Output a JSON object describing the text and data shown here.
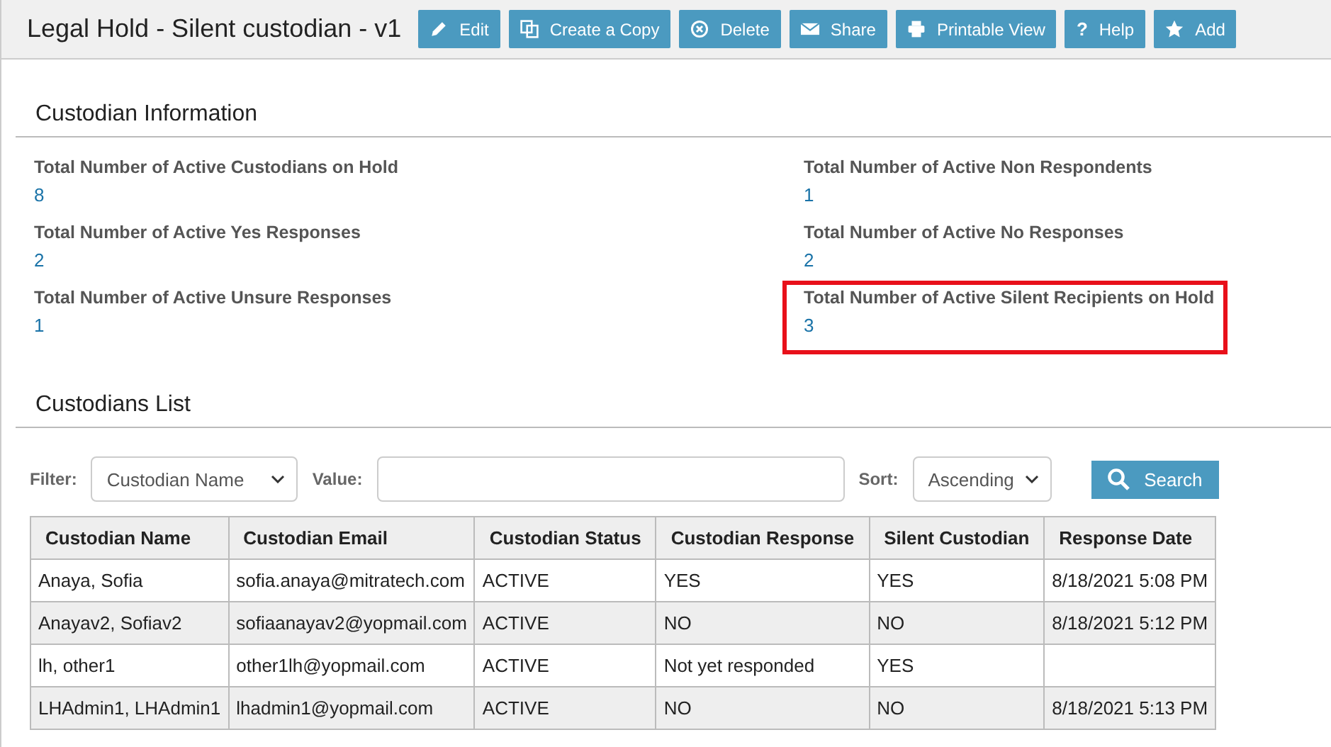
{
  "header": {
    "title": "Legal Hold - Silent custodian - v1",
    "buttons": [
      {
        "label": "Edit",
        "kind": "pencil"
      },
      {
        "label": "Create a Copy",
        "kind": "copy"
      },
      {
        "label": "Delete",
        "kind": "delete"
      },
      {
        "label": "Share",
        "kind": "mail"
      },
      {
        "label": "Printable View",
        "kind": "print"
      },
      {
        "label": "Help",
        "kind": "help",
        "glyph": "?"
      },
      {
        "label": "Add",
        "kind": "star"
      }
    ]
  },
  "custodian_info": {
    "title": "Custodian Information",
    "stats": [
      {
        "label": "Total Number of Active Custodians on Hold",
        "value": "8",
        "highlighted": false
      },
      {
        "label": "Total Number of Active Non Respondents",
        "value": "1",
        "highlighted": false
      },
      {
        "label": "Total Number of Active Yes Responses",
        "value": "2",
        "highlighted": false
      },
      {
        "label": "Total Number of Active No Responses",
        "value": "2",
        "highlighted": false
      },
      {
        "label": "Total Number of Active Unsure Responses",
        "value": "1",
        "highlighted": false
      },
      {
        "label": "Total Number of Active Silent Recipients on Hold",
        "value": "3",
        "highlighted": true
      }
    ]
  },
  "custodians_list": {
    "title": "Custodians List",
    "filter": {
      "label": "Filter:",
      "value": "Custodian Name"
    },
    "value_field": {
      "label": "Value:"
    },
    "sort": {
      "label": "Sort:",
      "value": "Ascending"
    },
    "search_button": "Search",
    "table": {
      "columns": [
        "Custodian Name",
        "Custodian Email",
        "Custodian Status",
        "Custodian Response",
        "Silent Custodian",
        "Response Date"
      ],
      "rows": [
        [
          "Anaya, Sofia",
          "sofia.anaya@mitratech.com",
          "ACTIVE",
          "YES",
          "YES",
          "8/18/2021 5:08 PM"
        ],
        [
          "Anayav2, Sofiav2",
          "sofiaanayav2@yopmail.com",
          "ACTIVE",
          "NO",
          "NO",
          "8/18/2021 5:12 PM"
        ],
        [
          "lh, other1",
          "other1lh@yopmail.com",
          "ACTIVE",
          "Not yet responded",
          "YES",
          ""
        ],
        [
          "LHAdmin1, LHAdmin1",
          "lhadmin1@yopmail.com",
          "ACTIVE",
          "NO",
          "NO",
          "8/18/2021 5:13 PM"
        ]
      ]
    }
  }
}
